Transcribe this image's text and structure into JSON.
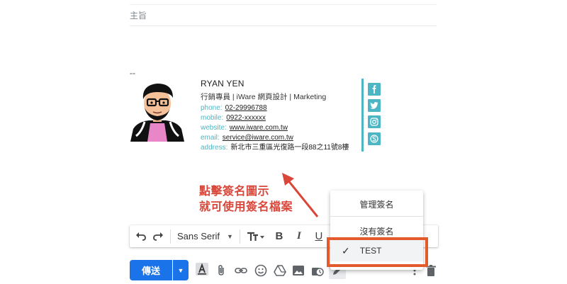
{
  "compose": {
    "subject_placeholder": "主旨",
    "signature_separator": "--"
  },
  "signature": {
    "name": "RYAN YEN",
    "title": "行銷專員 | iWare 網頁設計 | Marketing",
    "rows": [
      {
        "key": "phone:",
        "value": "02-29996788",
        "link": true
      },
      {
        "key": "mobile:",
        "value": "0922-xxxxxx",
        "link": true
      },
      {
        "key": "website:",
        "value": "www.iware.com.tw",
        "link": true
      },
      {
        "key": "email:",
        "value": "service@iware.com.tw",
        "link": true
      },
      {
        "key": "address:",
        "value": "新北市三重區光復路一段88之11號8樓",
        "link": false
      }
    ],
    "social_icons": [
      "facebook-icon",
      "twitter-icon",
      "instagram-icon",
      "skype-icon"
    ],
    "accent_color": "#4cb6c4"
  },
  "annotation": {
    "line1": "點擊簽名圖示",
    "line2": "就可使用簽名檔案",
    "color": "#d9473a"
  },
  "format_toolbar": {
    "font": "Sans Serif"
  },
  "bottom_bar": {
    "send_label": "傳送",
    "primary_color": "#1a73e8"
  },
  "signature_menu": {
    "manage_label": "管理簽名",
    "none_label": "沒有簽名",
    "selected_label": "TEST",
    "highlight_color": "#e35b2c"
  }
}
